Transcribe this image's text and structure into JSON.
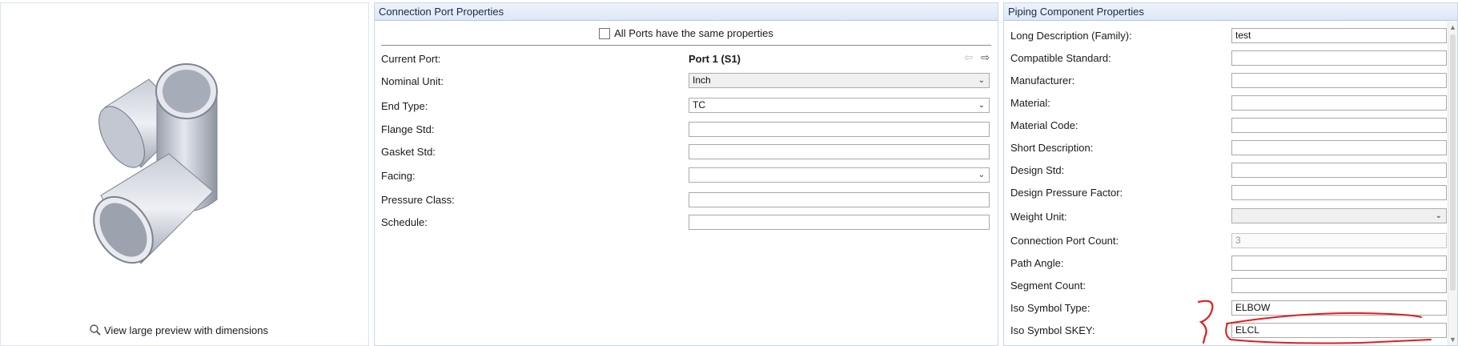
{
  "preview": {
    "link_label": "View large preview with dimensions",
    "icon": "magnifier-icon"
  },
  "port_panel": {
    "title": "Connection Port Properties",
    "same_props_label": "All Ports have the same properties",
    "same_props_checked": false,
    "current_port_label": "Current Port:",
    "current_port_value": "Port 1 (S1)",
    "prev_icon": "arrow-left-icon",
    "next_icon": "arrow-right-icon",
    "rows": [
      {
        "label": "Nominal Unit:",
        "value": "Inch"
      },
      {
        "label": "End Type:",
        "value": "TC"
      },
      {
        "label": "Flange Std:",
        "value": ""
      },
      {
        "label": "Gasket Std:",
        "value": ""
      },
      {
        "label": "Facing:",
        "value": ""
      },
      {
        "label": "Pressure Class:",
        "value": ""
      },
      {
        "label": "Schedule:",
        "value": ""
      }
    ]
  },
  "component_panel": {
    "title": "Piping Component Properties",
    "rows": [
      {
        "label": "Long Description (Family):",
        "value": "test"
      },
      {
        "label": "Compatible Standard:",
        "value": ""
      },
      {
        "label": "Manufacturer:",
        "value": ""
      },
      {
        "label": "Material:",
        "value": ""
      },
      {
        "label": "Material Code:",
        "value": ""
      },
      {
        "label": "Short Description:",
        "value": ""
      },
      {
        "label": "Design Std:",
        "value": ""
      },
      {
        "label": "Design Pressure Factor:",
        "value": ""
      },
      {
        "label": "Weight Unit:",
        "value": ""
      },
      {
        "label": "Connection Port Count:",
        "value": "3"
      },
      {
        "label": "Path Angle:",
        "value": ""
      },
      {
        "label": "Segment Count:",
        "value": ""
      },
      {
        "label": "Iso Symbol Type:",
        "value": "ELBOW"
      },
      {
        "label": "Iso Symbol SKEY:",
        "value": "ELCL"
      }
    ]
  },
  "colors": {
    "header_bg": "#dde7f5",
    "panel_border": "#c9d6e8",
    "annotation_red": "#e01e1e"
  }
}
